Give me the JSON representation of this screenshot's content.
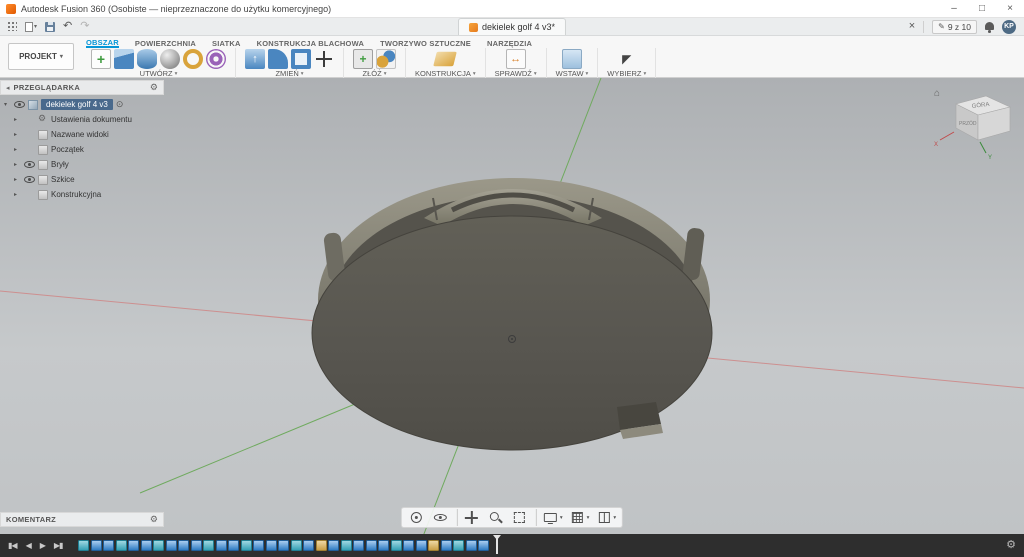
{
  "titlebar": {
    "title": "Autodesk Fusion 360 (Osobiste — nieprzeznaczone do użytku komercyjnego)"
  },
  "glyphs": {
    "minimize": "–",
    "maximize": "□",
    "close": "×",
    "caret_down": "▾",
    "tree_expanded": "▾",
    "tree_collapsed": "▸",
    "undo": "↶",
    "redo": "↷",
    "gear": "⚙",
    "pencil": "✎",
    "target": "⊙",
    "collapse_left": "◂",
    "home": "⌂"
  },
  "appbar": {
    "doc_tab": "dekielek golf 4 v3*",
    "quota": "9 z 10",
    "avatar": "KP"
  },
  "ribbon": {
    "project_button": "PROJEKT",
    "tabs": [
      {
        "label": "OBSZAR",
        "cls": "rtab active"
      },
      {
        "label": "POWIERZCHNIA",
        "cls": "rtab"
      },
      {
        "label": "SIATKA",
        "cls": "rtab"
      },
      {
        "label": "KONSTRUKCJA BLACHOWA",
        "cls": "rtab"
      },
      {
        "label": "TWORZYWO SZTUCZNE",
        "cls": "rtab"
      },
      {
        "label": "NARZĘDZIA",
        "cls": "rtab"
      }
    ],
    "groups": [
      {
        "label": "UTWÓRZ",
        "icons": [
          {
            "name": "create-sketch-icon",
            "cls": "ri ic-sketch"
          },
          {
            "name": "box-icon",
            "cls": "ri ic-box"
          },
          {
            "name": "cylinder-icon",
            "cls": "ri ic-cyl"
          },
          {
            "name": "sphere-icon",
            "cls": "ri ic-sphere"
          },
          {
            "name": "torus-icon",
            "cls": "ri ic-torus"
          },
          {
            "name": "coil-icon",
            "cls": "ri ic-coil"
          }
        ]
      },
      {
        "label": "ZMIEŃ",
        "icons": [
          {
            "name": "press-pull-icon",
            "cls": "ri ic-press"
          },
          {
            "name": "fillet-icon",
            "cls": "ri ic-fillet"
          },
          {
            "name": "shell-icon",
            "cls": "ri ic-shell"
          },
          {
            "name": "move-icon",
            "cls": "ri ic-move"
          }
        ]
      },
      {
        "label": "ZŁÓŻ",
        "icons": [
          {
            "name": "new-component-icon",
            "cls": "ri ic-newcomp"
          },
          {
            "name": "joint-icon",
            "cls": "ri ic-joint"
          }
        ]
      },
      {
        "label": "KONSTRUKCJA",
        "icons": [
          {
            "name": "construction-plane-icon",
            "cls": "ri ic-plane"
          }
        ]
      },
      {
        "label": "SPRAWDŹ",
        "icons": [
          {
            "name": "measure-icon",
            "cls": "ri ic-measure"
          }
        ]
      },
      {
        "label": "WSTAW",
        "icons": [
          {
            "name": "insert-icon",
            "cls": "ri ic-insert"
          }
        ]
      },
      {
        "label": "WYBIERZ",
        "icons": [
          {
            "name": "select-cursor-icon",
            "cls": "ri ic-select"
          }
        ]
      }
    ]
  },
  "browser": {
    "title": "PRZEGLĄDARKA",
    "root_label": "dekielek golf 4 v3",
    "items": [
      {
        "label": "Ustawienia dokumentu",
        "eyecls": "beye off",
        "iconcls": "bico gear"
      },
      {
        "label": "Nazwane widoki",
        "eyecls": "beye off",
        "iconcls": "bico folder"
      },
      {
        "label": "Początek",
        "eyecls": "beye off",
        "iconcls": "bico folder"
      },
      {
        "label": "Bryły",
        "eyecls": "beye",
        "iconcls": "bico folder"
      },
      {
        "label": "Szkice",
        "eyecls": "beye",
        "iconcls": "bico folder"
      },
      {
        "label": "Konstrukcyjna",
        "eyecls": "beye off",
        "iconcls": "bico folder"
      }
    ]
  },
  "comment": {
    "title": "KOMENTARZ"
  },
  "viewcube": {
    "top_label": "GÓRA",
    "front_label": "PRZÓD",
    "axis_x": "X",
    "axis_y": "Y"
  },
  "navbar": {
    "items": [
      {
        "name": "orbit-tool",
        "wcls": "nvbtn",
        "cls": "nvi nv-orbit",
        "caret": ""
      },
      {
        "name": "look-at-tool",
        "wcls": "nvbtn",
        "cls": "nvi nv-look",
        "caret": ""
      },
      {
        "name": "pan-tool",
        "wcls": "nvbtn sep",
        "cls": "nvi nv-pan",
        "caret": ""
      },
      {
        "name": "zoom-tool",
        "wcls": "nvbtn",
        "cls": "nvi nv-zoom",
        "caret": ""
      },
      {
        "name": "fit-tool",
        "wcls": "nvbtn",
        "cls": "nvi nv-fit",
        "caret": ""
      },
      {
        "name": "display-settings-button",
        "wcls": "nvbtn sep",
        "cls": "nvi nv-display",
        "caret": "▾"
      },
      {
        "name": "grid-settings-button",
        "wcls": "nvbtn",
        "cls": "nvi nv-grid",
        "caret": "▾"
      },
      {
        "name": "viewport-layout-button",
        "wcls": "nvbtn",
        "cls": "nvi nv-layout",
        "caret": "▾"
      }
    ]
  },
  "timeline": {
    "controls": [
      "▮◀",
      "◀",
      "▶",
      "▶▮"
    ],
    "icons": [
      "tli t-sk",
      "tli t-ft",
      "tli t-ft",
      "tli t-sk",
      "tli t-ft",
      "tli t-ft",
      "tli t-sk",
      "tli t-ft",
      "tli t-ft",
      "tli t-ft",
      "tli t-sk",
      "tli t-ft",
      "tli t-ft",
      "tli t-sk",
      "tli t-ft",
      "tli t-ft",
      "tli t-ft",
      "tli t-sk",
      "tli t-ft",
      "tli t-gold",
      "tli t-ft",
      "tli t-sk",
      "tli t-ft",
      "tli t-ft",
      "tli t-ft",
      "tli t-sk",
      "tli t-ft",
      "tli t-ft",
      "tli t-gold",
      "tli t-ft",
      "tli t-sk",
      "tli t-ft",
      "tli t-ft"
    ]
  },
  "colors": {
    "accent": "#0696d7",
    "axis_green": "#6faa5e",
    "axis_red": "#cd8f8f",
    "model_face": "#5a5850"
  }
}
